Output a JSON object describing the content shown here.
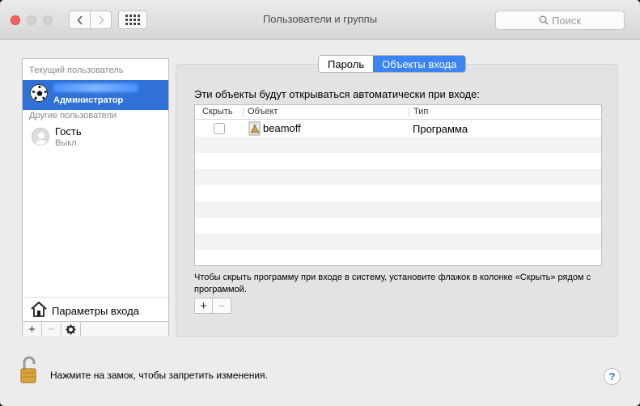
{
  "window": {
    "title": "Пользователи и группы"
  },
  "search": {
    "placeholder": "Поиск"
  },
  "sidebar": {
    "current_header": "Текущий пользователь",
    "current_user": {
      "role": "Администратор"
    },
    "others_header": "Другие пользователи",
    "guest": {
      "name": "Гость",
      "status": "Выкл."
    },
    "login_options_label": "Параметры входа",
    "buttons": [
      "+",
      "−"
    ]
  },
  "tabs": [
    {
      "label": "Пароль",
      "active": false
    },
    {
      "label": "Объекты входа",
      "active": true
    }
  ],
  "main": {
    "description": "Эти объекты будут открываться автоматически при входе:",
    "columns": [
      "Скрыть",
      "Объект",
      "Тип"
    ],
    "rows": [
      {
        "hide": false,
        "name": "beamoff",
        "type": "Программа"
      }
    ],
    "hint": "Чтобы скрыть программу при входе в систему, установите флажок в колонке «Скрыть» рядом с программой.",
    "add_button": "+",
    "remove_button": "−"
  },
  "footer": {
    "lock_text": "Нажмите на замок, чтобы запретить изменения.",
    "help_label": "?"
  },
  "colors": {
    "selection": "#2f71d6",
    "active_tab": "#3b84f4"
  }
}
